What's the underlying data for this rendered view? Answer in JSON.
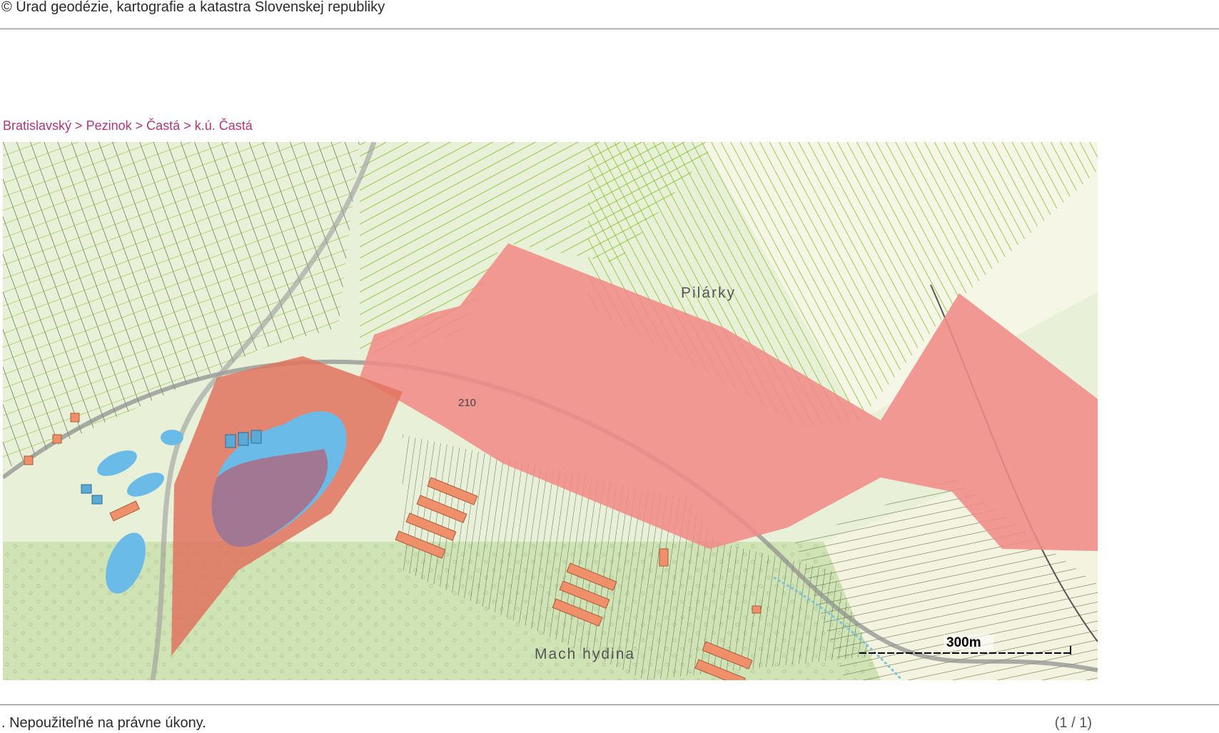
{
  "header": {
    "copyright": "© Úrad geodézie, kartografie a katastra Slovenskej republiky"
  },
  "breadcrumb": {
    "items": [
      "Bratislavský",
      "Pezinok",
      "Častá",
      "k.ú. Častá"
    ],
    "separator": ">"
  },
  "map": {
    "labels": {
      "area_north": "Pilárky",
      "area_south": "Mach hydina",
      "road_number": "210"
    },
    "scale_bar": {
      "label": "300m"
    },
    "colors": {
      "highlight_zone": "#f08b86",
      "parcel_lines": "#7cbf1e",
      "water": "#6bbbe8",
      "buildings": "#f0906a",
      "forest": "#cfe3b5"
    }
  },
  "footer": {
    "disclaimer": ". Nepoužiteľné na právne úkony.",
    "page_indicator": "(1 / 1)"
  }
}
